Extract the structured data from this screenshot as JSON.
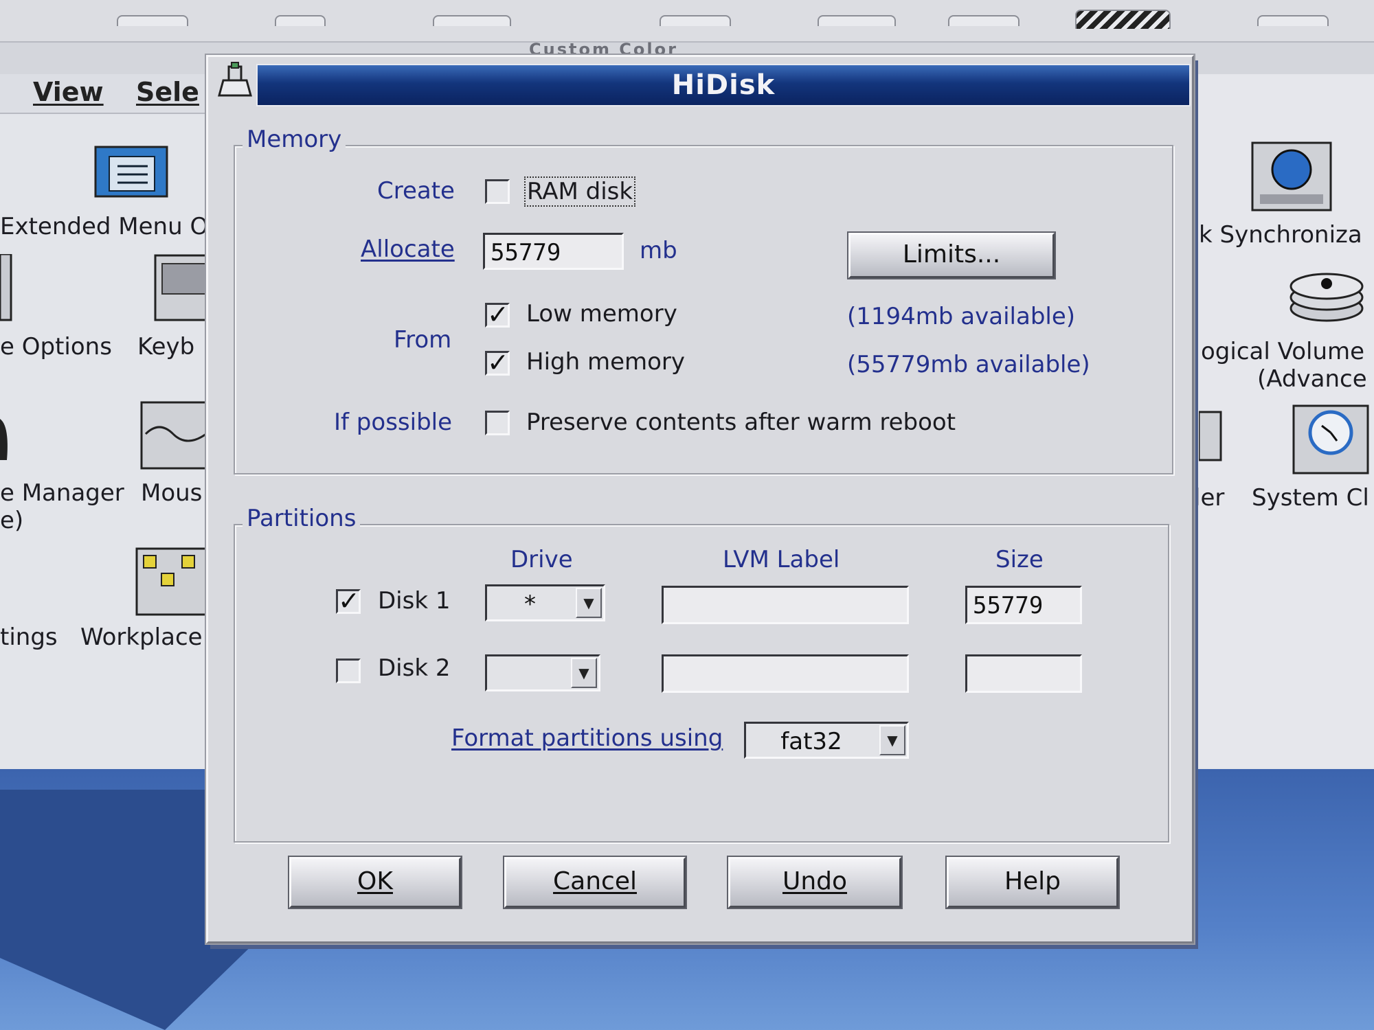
{
  "background": {
    "menu": [
      "View",
      "Sele"
    ],
    "title_fragment": "Custom Color",
    "left_icons": [
      {
        "label": "Extended Menu O",
        "icon": "menu-config-icon"
      },
      {
        "label": "e Options",
        "icon": "device-icon"
      },
      {
        "label": "Keyb",
        "icon": "keyboard-icon"
      },
      {
        "label": "e Manager",
        "icon": "device-icon"
      },
      {
        "label": "e)",
        "icon": ""
      },
      {
        "label": "Mous",
        "icon": "mouse-icon"
      },
      {
        "label": "tings",
        "icon": ""
      },
      {
        "label": "Workplace",
        "icon": "workplace-icon"
      }
    ],
    "right_icons": [
      {
        "label": "k Synchroniza",
        "icon": "clock-sync-icon"
      },
      {
        "label": "ogical Volume M",
        "icon": "disk-stack-icon"
      },
      {
        "label": "(Advance",
        "icon": ""
      },
      {
        "label": "ler",
        "icon": "scheduler-icon"
      },
      {
        "label": "System Cl",
        "icon": "system-clock-icon"
      }
    ]
  },
  "dialog": {
    "title": "HiDisk",
    "memory": {
      "group_title": "Memory",
      "create_label": "Create",
      "ram_disk": {
        "label": "RAM disk",
        "checked": false
      },
      "allocate_label": "Allocate",
      "allocate_value": "55779",
      "allocate_unit": "mb",
      "limits_button": "Limits...",
      "from_label": "From",
      "low_memory": {
        "label": "Low memory",
        "checked": true,
        "available": "(1194mb available)"
      },
      "high_memory": {
        "label": "High memory",
        "checked": true,
        "available": "(55779mb available)"
      },
      "if_possible_label": "If possible",
      "preserve": {
        "label": "Preserve contents after warm reboot",
        "checked": false
      }
    },
    "partitions": {
      "group_title": "Partitions",
      "headers": {
        "drive": "Drive",
        "lvm_label": "LVM Label",
        "size": "Size"
      },
      "rows": [
        {
          "label": "Disk 1",
          "checked": true,
          "drive": "*",
          "lvm_label": "",
          "size": "55779"
        },
        {
          "label": "Disk 2",
          "checked": false,
          "drive": "",
          "lvm_label": "",
          "size": ""
        }
      ],
      "format_label": "Format partitions using",
      "format_value": "fat32"
    },
    "buttons": {
      "ok": "OK",
      "cancel": "Cancel",
      "undo": "Undo",
      "help": "Help"
    }
  },
  "colors": {
    "title_bar": "#13357c",
    "label_blue": "#23308d",
    "dialog_bg": "#d9dadf"
  }
}
